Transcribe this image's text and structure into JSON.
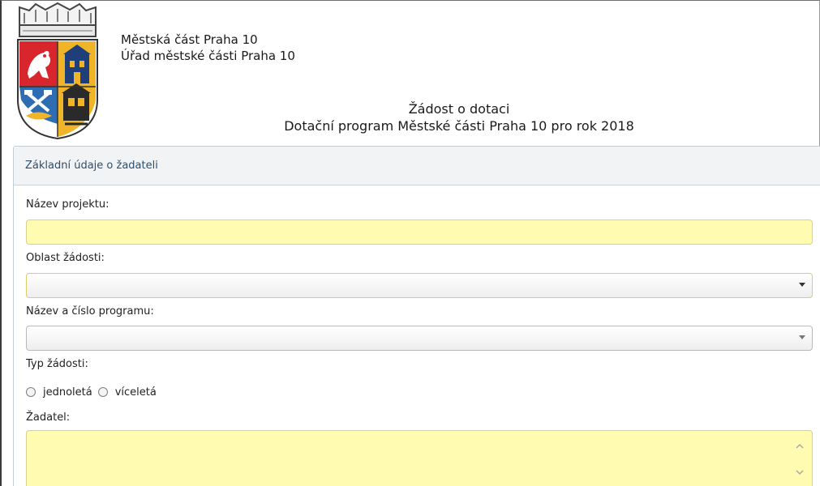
{
  "header": {
    "org_line1": "Městská část Praha 10",
    "org_line2": "Úřad městské části Praha 10",
    "title": "Žádost o dotaci",
    "subtitle": "Dotační program Městské části Praha 10 pro rok 2018"
  },
  "panel": {
    "title": "Základní údaje o žadateli"
  },
  "form": {
    "project_name_label": "Název projektu:",
    "project_name_value": "",
    "area_label": "Oblast žádosti:",
    "area_value": "",
    "program_label": "Název a číslo programu:",
    "program_value": "",
    "type_label": "Typ žádosti:",
    "type_options": [
      "jednoletá",
      "víceletá"
    ],
    "applicant_label": "Žadatel:",
    "applicant_value": ""
  },
  "colors": {
    "required_field_bg": "#fffbb0",
    "panel_header_bg": "#f1f3f5",
    "panel_title_text": "#2b4f6e"
  },
  "icons": {
    "coat_of_arms": "praha-10-coat-of-arms",
    "select_arrow": "caret-down",
    "scroll_up": "chevron-up",
    "scroll_down": "chevron-down"
  }
}
